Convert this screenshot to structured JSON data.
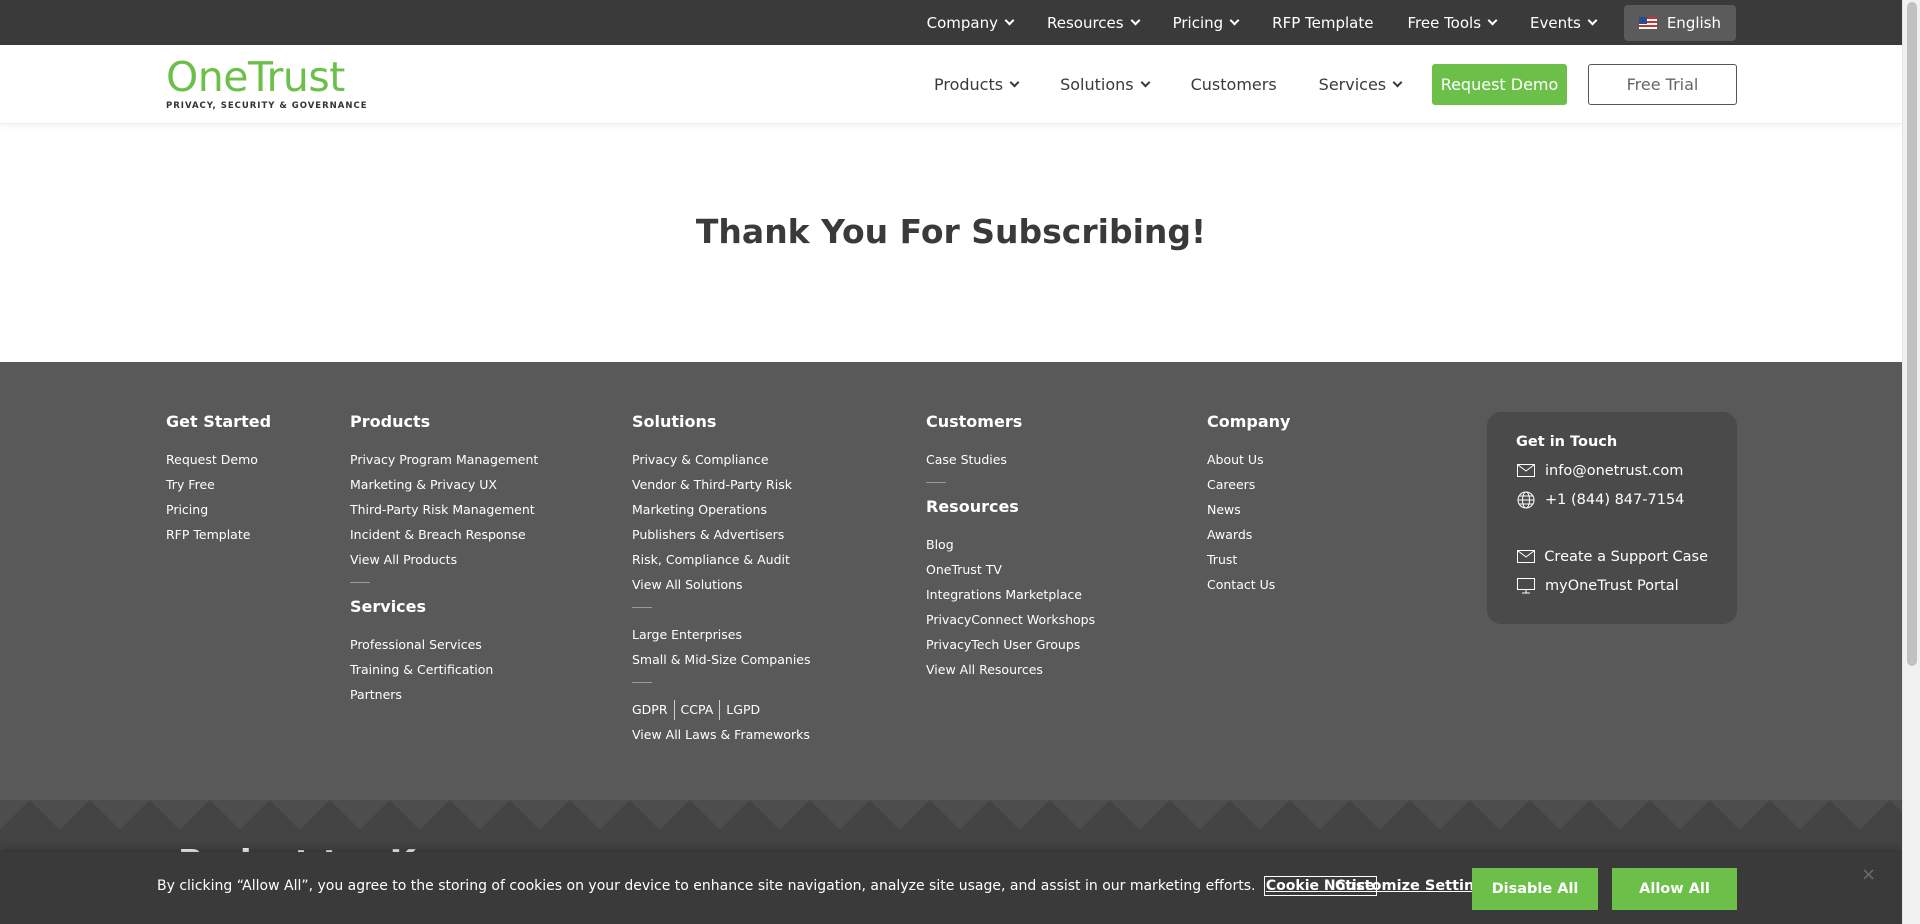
{
  "topbar": {
    "items": [
      {
        "label": "Company",
        "dropdown": true
      },
      {
        "label": "Resources",
        "dropdown": true
      },
      {
        "label": "Pricing",
        "dropdown": true
      },
      {
        "label": "RFP Template",
        "dropdown": false
      },
      {
        "label": "Free Tools",
        "dropdown": true
      },
      {
        "label": "Events",
        "dropdown": true
      }
    ],
    "language": "English"
  },
  "header": {
    "logo_text": "OneTrust",
    "logo_tagline": "PRIVACY, SECURITY & GOVERNANCE",
    "nav": [
      {
        "label": "Products",
        "dropdown": true
      },
      {
        "label": "Solutions",
        "dropdown": true
      },
      {
        "label": "Customers",
        "dropdown": false
      },
      {
        "label": "Services",
        "dropdown": true
      }
    ],
    "request_demo": "Request Demo",
    "free_trial": "Free Trial"
  },
  "hero": {
    "title": "Thank You For Subscribing!"
  },
  "footer": {
    "get_started": {
      "title": "Get Started",
      "links": [
        "Request Demo",
        "Try Free",
        "Pricing",
        "RFP Template"
      ]
    },
    "products": {
      "title": "Products",
      "links": [
        "Privacy Program Management",
        "Marketing & Privacy UX",
        "Third-Party Risk Management",
        "Incident & Breach Response",
        "View All Products"
      ]
    },
    "services": {
      "title": "Services",
      "links": [
        "Professional Services",
        "Training & Certification",
        "Partners"
      ]
    },
    "solutions": {
      "title": "Solutions",
      "links": [
        "Privacy & Compliance",
        "Vendor & Third-Party Risk",
        "Marketing Operations",
        "Publishers & Advertisers",
        "Risk, Compliance & Audit",
        "View All Solutions"
      ],
      "links2": [
        "Large Enterprises",
        "Small & Mid-Size Companies"
      ],
      "laws": [
        "GDPR",
        "CCPA",
        "LGPD"
      ],
      "laws_link": "View All Laws & Frameworks"
    },
    "customers": {
      "title": "Customers",
      "links": [
        "Case Studies"
      ]
    },
    "resources": {
      "title": "Resources",
      "links": [
        "Blog",
        "OneTrust TV",
        "Integrations Marketplace",
        "PrivacyConnect Workshops",
        "PrivacyTech User Groups",
        "View All Resources"
      ]
    },
    "company": {
      "title": "Company",
      "links": [
        "About Us",
        "Careers",
        "News",
        "Awards",
        "Trust",
        "Contact Us"
      ]
    },
    "contact": {
      "title": "Get in Touch",
      "email": "info@onetrust.com",
      "phone": "+1 (844) 847-7154",
      "support": "Create a Support Case",
      "portal": "myOneTrust Portal"
    }
  },
  "strip": {
    "title": "Redact t... K"
  },
  "cookie": {
    "text": "By clicking “Allow All”, you agree to the storing of cookies on your device to enhance site navigation, analyze site usage, and assist in our marketing efforts.",
    "notice": "Cookie Notice",
    "customize": "Customize Settings",
    "disable": "Disable All",
    "allow": "Allow All",
    "close": "×"
  },
  "colors": {
    "brand_green": "#6cc04a",
    "topbar_bg": "#3a3a3a",
    "footer_bg": "#595959"
  }
}
